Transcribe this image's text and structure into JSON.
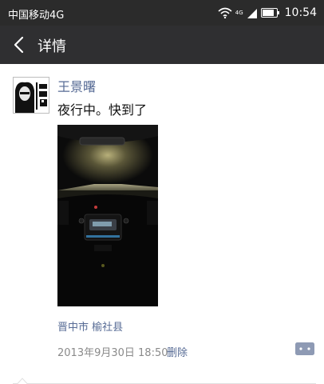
{
  "status_bar": {
    "carrier": "中国移动4G",
    "network_label": "4G",
    "time": "10:54",
    "icons": [
      "wifi-icon",
      "signal-icon",
      "battery-icon"
    ]
  },
  "nav": {
    "title": "详情",
    "back_icon": "chevron-left-icon"
  },
  "post": {
    "author": "王景曙",
    "text": "夜行中。快到了",
    "photo_alt": "night-drive-car-interior-photo",
    "location": "晋中市 榆社县",
    "timestamp": "2013年9月30日 18:50",
    "delete_label": "删除",
    "comment_icon": "comment-bubble-icon"
  },
  "colors": {
    "status_bar_bg": "#2b2b2b",
    "nav_bg": "#2f2f31",
    "link_blue": "#576b95",
    "meta_gray": "#8a8a8a",
    "comment_button_bg": "#8e9ab4"
  }
}
